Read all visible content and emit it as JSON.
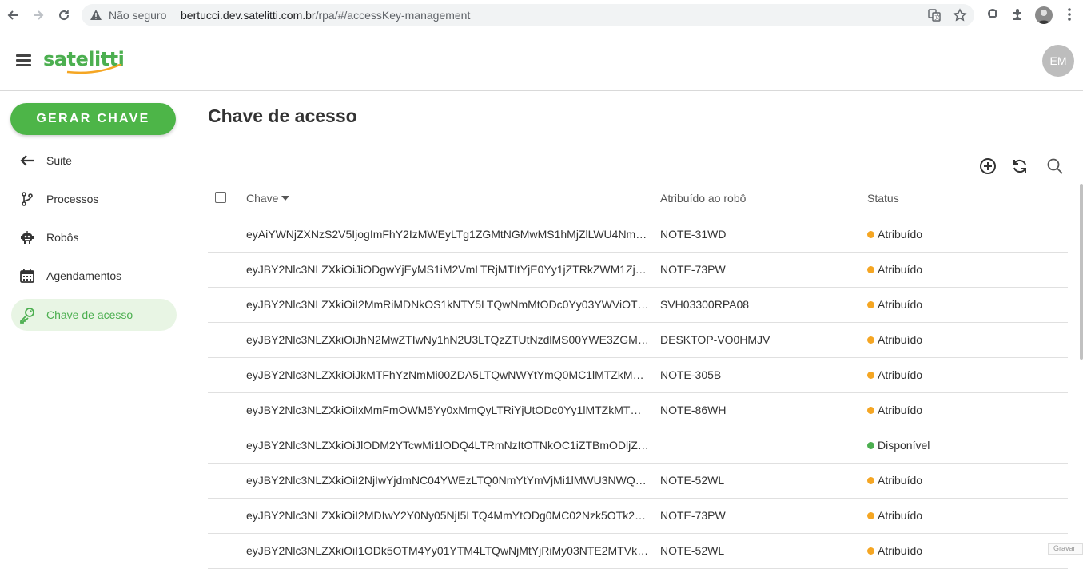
{
  "browser": {
    "insecure_label": "Não seguro",
    "url_host": "bertucci.dev.satelitti.com.br",
    "url_path": "/rpa/#/accessKey-management"
  },
  "header": {
    "logo_text": "satelitti",
    "avatar_initials": "EM"
  },
  "sidebar": {
    "primary_button": "GERAR CHAVE",
    "items": [
      {
        "label": "Suite",
        "icon": "arrow-left-icon"
      },
      {
        "label": "Processos",
        "icon": "branch-icon"
      },
      {
        "label": "Robôs",
        "icon": "robot-icon"
      },
      {
        "label": "Agendamentos",
        "icon": "calendar-icon"
      },
      {
        "label": "Chave de acesso",
        "icon": "key-icon",
        "active": true
      }
    ]
  },
  "main": {
    "title": "Chave de acesso",
    "columns": {
      "key": "Chave",
      "robot": "Atribuído ao robô",
      "status": "Status"
    },
    "rows": [
      {
        "key": "eyAiYWNjZXNzS2V5IjogImFhY2IzMWEyLTg1ZGMtNGMwMS1hMjZlLWU4NmU...",
        "robot": "NOTE-31WD",
        "status": "Atribuído",
        "status_color": "#f5a623"
      },
      {
        "key": "eyJBY2Nlc3NLZXkiOiJiODgwYjEyMS1iM2VmLTRjMTItYjE0Yy1jZTRkZWM1ZjM...",
        "robot": "NOTE-73PW",
        "status": "Atribuído",
        "status_color": "#f5a623"
      },
      {
        "key": "eyJBY2Nlc3NLZXkiOiI2MmRiMDNkOS1kNTY5LTQwNmMtODc0Yy03YWViOTg4...",
        "robot": "SVH03300RPA08",
        "status": "Atribuído",
        "status_color": "#f5a623"
      },
      {
        "key": "eyJBY2Nlc3NLZXkiOiJhN2MwZTIwNy1hN2U3LTQzZTUtNzdlMS00YWE3ZGM0...",
        "robot": "DESKTOP-VO0HMJV",
        "status": "Atribuído",
        "status_color": "#f5a623"
      },
      {
        "key": "eyJBY2Nlc3NLZXkiOiJkMTFhYzNmMi00ZDA5LTQwNWYtYmQ0MC1lMTZkMTQ...",
        "robot": "NOTE-305B",
        "status": "Atribuído",
        "status_color": "#f5a623"
      },
      {
        "key": "eyJBY2Nlc3NLZXkiOiIxMmFmOWM5Yy0xMmQyLTRiYjUtODc0Yy1lMTZkMTQ0...",
        "robot": "NOTE-86WH",
        "status": "Atribuído",
        "status_color": "#f5a623"
      },
      {
        "key": "eyJBY2Nlc3NLZXkiOiJlODM2YTcwMi1lODQ4LTRmNzItOTNkOC1iZTBmODljZm...",
        "robot": "",
        "status": "Disponível",
        "status_color": "#4caf50"
      },
      {
        "key": "eyJBY2Nlc3NLZXkiOiI2NjIwYjdmNC04YWEzLTQ0NmYtYmVjMi1lMWU3NWQz...",
        "robot": "NOTE-52WL",
        "status": "Atribuído",
        "status_color": "#f5a623"
      },
      {
        "key": "eyJBY2Nlc3NLZXkiOiI2MDIwY2Y0Ny05NjI5LTQ4MmYtODg0MC02Nzk5OTk2Z...",
        "robot": "NOTE-73PW",
        "status": "Atribuído",
        "status_color": "#f5a623"
      },
      {
        "key": "eyJBY2Nlc3NLZXkiOiI1ODk5OTM4Yy01YTM4LTQwNjMtYjRiMy03NTE2MTVkMi...",
        "robot": "NOTE-52WL",
        "status": "Atribuído",
        "status_color": "#f5a623"
      }
    ]
  },
  "footer": {
    "gravar_label": "Gravar"
  },
  "colors": {
    "brand_green": "#4db548",
    "assigned": "#f5a623",
    "available": "#4caf50"
  }
}
